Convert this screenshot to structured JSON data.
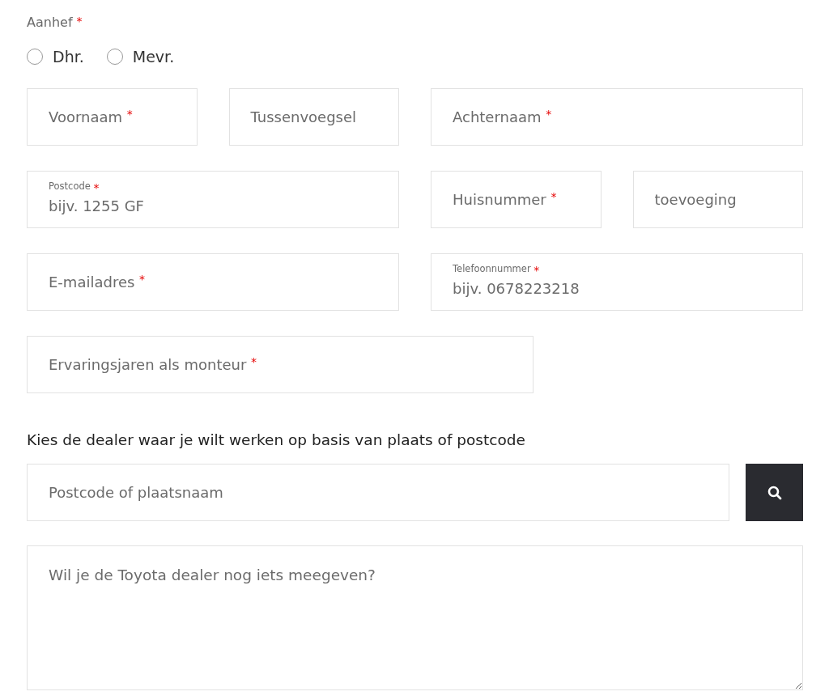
{
  "salutation": {
    "label": "Aanhef",
    "mark": "*",
    "options": [
      {
        "label": "Dhr.",
        "selected": false
      },
      {
        "label": "Mevr.",
        "selected": false
      }
    ]
  },
  "rows": [
    [
      {
        "kind": "plain",
        "label": "Voornaam",
        "mark": "*"
      },
      {
        "kind": "plain",
        "label": "Tussenvoegsel"
      },
      {
        "kind": "plain",
        "label": "Achternaam",
        "mark": "*"
      }
    ],
    [
      {
        "kind": "floating",
        "label": "Postcode",
        "mark": "*",
        "placeholder": "bijv. 1255 GF"
      },
      {
        "kind": "plain",
        "label": "Huisnummer",
        "mark": "*"
      },
      {
        "kind": "plain",
        "label": "toevoeging"
      }
    ],
    [
      {
        "kind": "plain",
        "label": "E-mailadres",
        "mark": "*"
      },
      {
        "kind": "floating",
        "label": "Telefoonnummer",
        "mark": "*",
        "placeholder": "bijv. 0678223218"
      }
    ],
    [
      {
        "kind": "plain",
        "label": "Ervaringsjaren als monteur",
        "mark": "*"
      }
    ]
  ],
  "dealer": {
    "heading": "Kies de dealer waar je wilt werken op basis van plaats of postcode",
    "placeholder": "Postcode of plaatsnaam"
  },
  "message": {
    "placeholder": "Wil je de Toyota dealer nog iets meegeven?"
  }
}
